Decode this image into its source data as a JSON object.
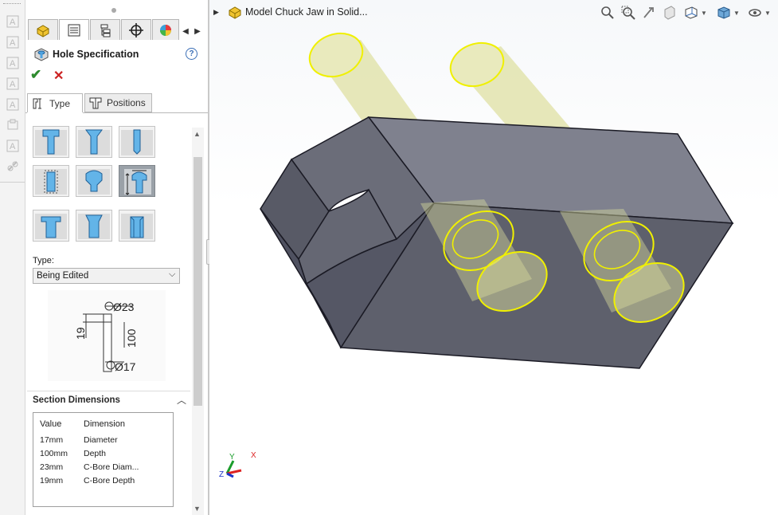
{
  "colors": {
    "accent": "#3b6fb6",
    "ok": "#2e8b2e",
    "cancel": "#cc2222",
    "model_body": "#71737f",
    "cylinder_fill": "#dfe0a6",
    "cylinder_edge": "#f0f000"
  },
  "left_toolbar": {
    "icons": [
      "text-icon",
      "annotation-icon",
      "balloon-icon",
      "surface-finish-icon",
      "datum-icon",
      "weld-icon",
      "hole-callout-icon",
      "link-icon"
    ]
  },
  "property_manager": {
    "tabs": [
      "feature-manager-icon",
      "property-manager-icon",
      "configuration-manager-icon",
      "dim-xpert-icon",
      "appearance-icon"
    ],
    "title": "Hole Specification",
    "help": "?",
    "ok": "✔",
    "cancel": "✕",
    "subtabs": {
      "type": "Type",
      "positions": "Positions"
    },
    "hole_types": [
      "counterbore-hole",
      "countersink-hole",
      "straight-hole",
      "counterbore-slot",
      "countersink-slot",
      "legacy-hole",
      "tapped-hole",
      "pipe-tap-hole",
      "slot-hole"
    ],
    "selected_hole_type": 6,
    "type_label": "Type:",
    "type_value": "Being Edited",
    "drawing": {
      "cbore_diameter": "Ø23",
      "cbore_depth": "19",
      "depth": "100",
      "diameter": "Ø17"
    },
    "section": {
      "title": "Section Dimensions",
      "columns": {
        "value": "Value",
        "dimension": "Dimension"
      },
      "rows": [
        {
          "value": "17mm",
          "dimension": "Diameter"
        },
        {
          "value": "100mm",
          "dimension": "Depth"
        },
        {
          "value": "23mm",
          "dimension": "C-Bore Diam..."
        },
        {
          "value": "19mm",
          "dimension": "C-Bore Depth"
        }
      ]
    }
  },
  "viewport": {
    "model_name": "Model Chuck Jaw in Solid...",
    "hud_icons": [
      "zoom-to-fit-icon",
      "zoom-area-icon",
      "previous-view-icon",
      "section-view-icon",
      "view-orientation-icon",
      "display-style-icon",
      "hide-show-icon"
    ],
    "triad": {
      "x": "X",
      "y": "Y",
      "z": "Z"
    }
  }
}
